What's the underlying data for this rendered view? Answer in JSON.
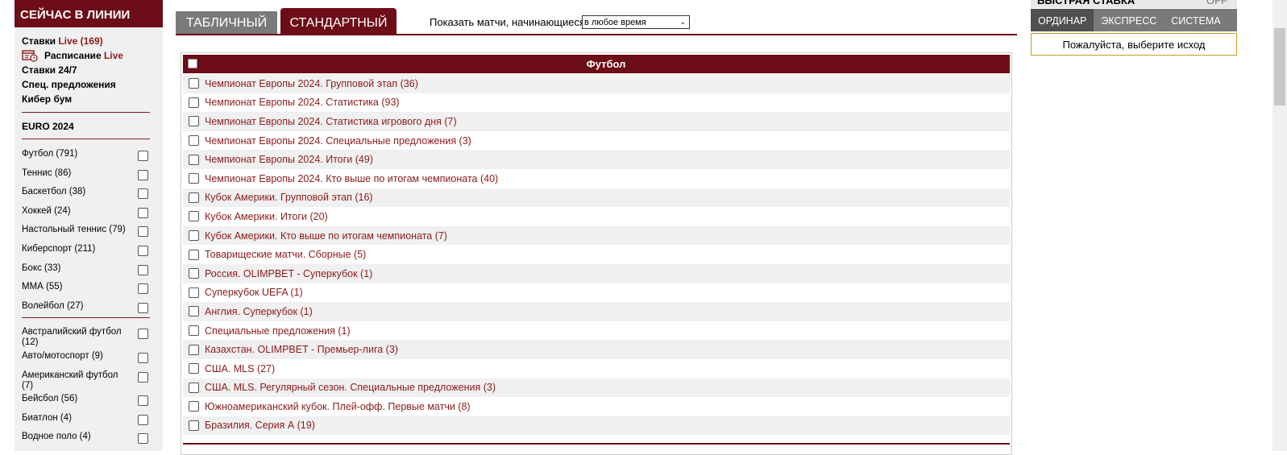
{
  "sidebar": {
    "title": "СЕЙЧАС В ЛИНИИ",
    "links": {
      "live_bets": {
        "prefix": "Ставки ",
        "live": "Live",
        "count": " (169)"
      },
      "schedule": {
        "prefix": "Расписание ",
        "live": "Live"
      },
      "bets247": "Ставки 24/7",
      "special": "Спец. предложения",
      "cyber": "Кибер бум"
    },
    "euro": "EURO 2024",
    "sports": [
      "Футбол (791)",
      "Теннис (86)",
      "Баскетбол (38)",
      "Хоккей (24)",
      "Настольный теннис (79)",
      "Киберспорт (211)",
      "Бокс (33)",
      "ММА (55)",
      "Волейбол (27)"
    ],
    "sports_more": [
      "Австралийский футбол (12)",
      "Авто/мотоспорт (9)",
      "Американский футбол (7)",
      "Бейсбол (56)",
      "Биатлон (4)",
      "Водное поло (4)"
    ]
  },
  "tabs": {
    "table": "ТАБЛИЧНЫЙ",
    "standard": "СТАНДАРТНЫЙ"
  },
  "filter": {
    "label": "Показать матчи, начинающиеся",
    "value": "в любое время"
  },
  "panel": {
    "title": "Футбол",
    "leagues": [
      "Чемпионат Европы 2024. Групповой этап (36)",
      "Чемпионат Европы 2024. Статистика (93)",
      "Чемпионат Европы 2024. Статистика игрового дня (7)",
      "Чемпионат Европы 2024. Специальные предложения (3)",
      "Чемпионат Европы 2024. Итоги (49)",
      "Чемпионат Европы 2024. Кто выше по итогам чемпионата (40)",
      "Кубок Америки. Групповой этап (16)",
      "Кубок Америки. Итоги (20)",
      "Кубок Америки. Кто выше по итогам чемпионата (7)",
      "Товарищеские матчи. Сборные (5)",
      "Россия. OLIMPBET - Суперкубок (1)",
      "Суперкубок UEFA (1)",
      "Англия. Суперкубок (1)",
      "Специальные предложения (1)",
      "Казахстан. OLIMPBET - Премьер-лига (3)",
      "США. MLS (27)",
      "США. MLS. Регулярный сезон. Специальные предложения (3)",
      "Южноамериканский кубок. Плей-офф. Первые матчи (8)",
      "Бразилия. Серия А (19)"
    ]
  },
  "slip": {
    "title": "БЫСТРАЯ СТАВКА",
    "toggle": "OFF",
    "tabs": [
      "ОРДИНАР",
      "ЭКСПРЕСС",
      "СИСТЕМА"
    ],
    "message": "Пожалуйста, выберите исход"
  },
  "colors": {
    "brand": "#6d0d17",
    "link": "#8b1a1a",
    "tab_gray": "#7a7a7a"
  }
}
